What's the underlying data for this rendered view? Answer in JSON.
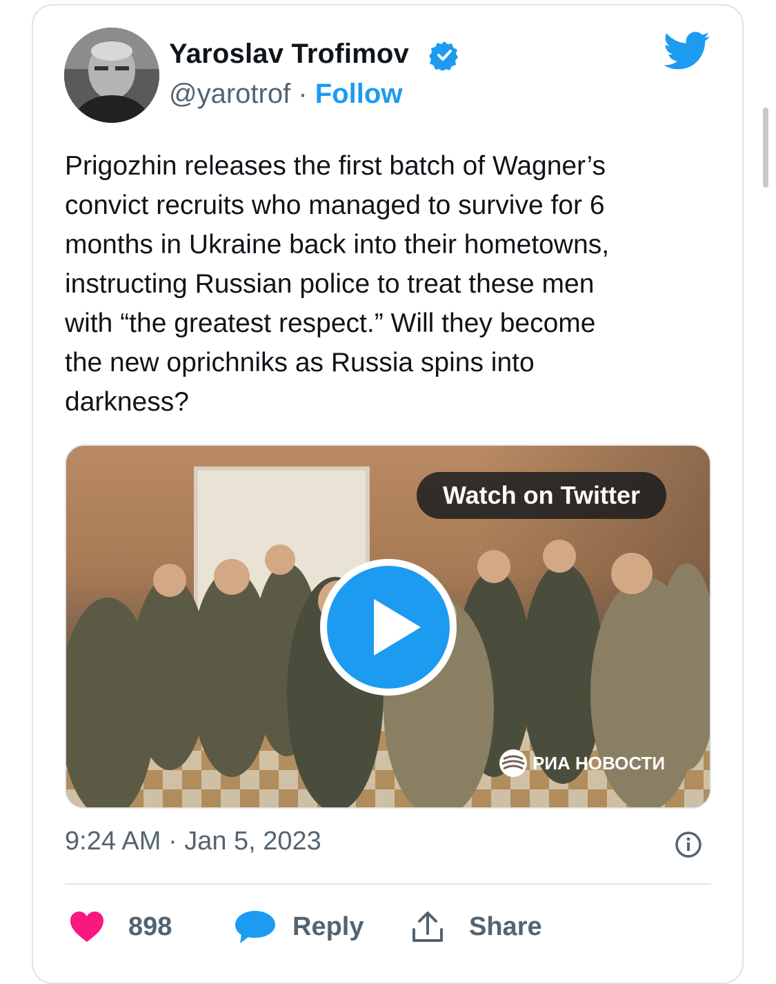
{
  "author": {
    "name": "Yaroslav Trofimov",
    "handle": "@yarotrof",
    "separator": "·",
    "follow_label": "Follow",
    "verified": true
  },
  "tweet": {
    "text": "Prigozhin releases the first batch of Wagner’s\nconvict recruits who managed to survive for 6\nmonths in Ukraine back into their hometowns,\ninstructing Russian police to treat these men\nwith “the greatest respect.” Will they become\nthe new oprichniks as Russia spins into\ndarkness?",
    "timestamp": "9:24 AM · Jan 5, 2023"
  },
  "media": {
    "watch_label": "Watch on Twitter",
    "watermark": "РИА НОВОСТИ",
    "play_icon": "play-icon"
  },
  "actions": {
    "like_count": "898",
    "reply_label": "Reply",
    "share_label": "Share"
  },
  "colors": {
    "accent": "#1d9bf0",
    "like": "#f91880",
    "muted": "#536471",
    "text": "#0f1419"
  },
  "icons": [
    "twitter-bird-icon",
    "verified-badge-icon",
    "play-icon",
    "info-icon",
    "heart-icon",
    "reply-bubble-icon",
    "share-icon",
    "ria-logo-icon"
  ]
}
